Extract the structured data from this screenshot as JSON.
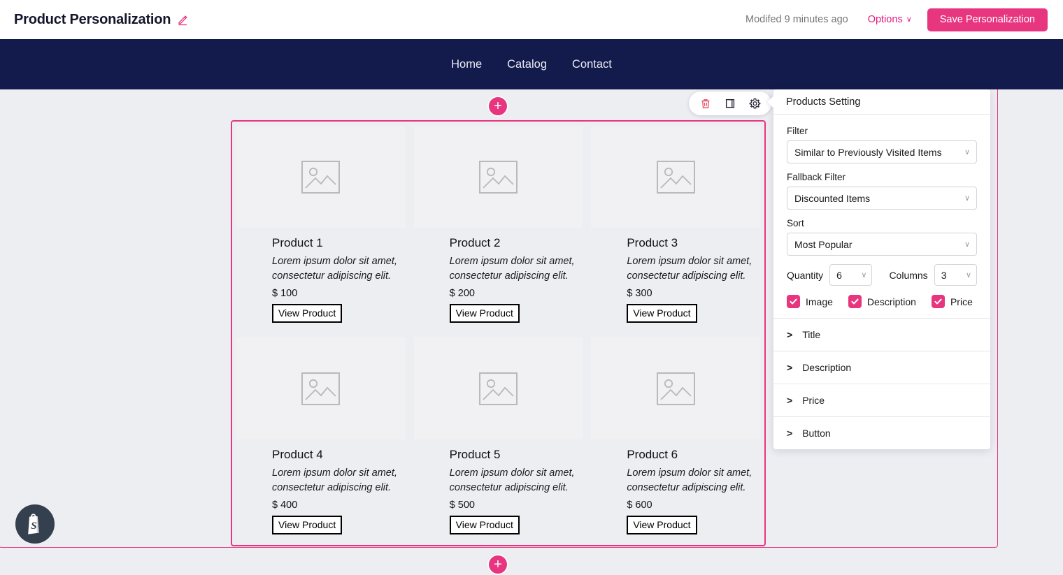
{
  "header": {
    "title": "Product Personalization",
    "edit_icon": "pencil-icon",
    "modified": "Modifed 9 minutes ago",
    "options_label": "Options",
    "options_caret": "∨",
    "save_label": "Save Personalization"
  },
  "storenav": {
    "items": [
      {
        "label": "Home"
      },
      {
        "label": "Catalog"
      },
      {
        "label": "Contact"
      }
    ]
  },
  "canvas": {
    "add_button_label": "+",
    "toolbar": [
      {
        "icon": "trash-icon"
      },
      {
        "icon": "duplicate-icon"
      },
      {
        "icon": "gear-icon"
      }
    ],
    "shopify_badge_icon": "shopify-bag-icon"
  },
  "products": [
    {
      "title": "Product 1",
      "description": "Lorem ipsum dolor sit amet, consectetur adipiscing elit.",
      "price": "$ 100",
      "button": "View Product",
      "image_icon": "image-placeholder-icon"
    },
    {
      "title": "Product 2",
      "description": "Lorem ipsum dolor sit amet, consectetur adipiscing elit.",
      "price": "$ 200",
      "button": "View Product",
      "image_icon": "image-placeholder-icon"
    },
    {
      "title": "Product 3",
      "description": "Lorem ipsum dolor sit amet, consectetur adipiscing elit.",
      "price": "$ 300",
      "button": "View Product",
      "image_icon": "image-placeholder-icon"
    },
    {
      "title": "Product 4",
      "description": "Lorem ipsum dolor sit amet, consectetur adipiscing elit.",
      "price": "$ 400",
      "button": "View Product",
      "image_icon": "image-placeholder-icon"
    },
    {
      "title": "Product 5",
      "description": "Lorem ipsum dolor sit amet, consectetur adipiscing elit.",
      "price": "$ 500",
      "button": "View Product",
      "image_icon": "image-placeholder-icon"
    },
    {
      "title": "Product 6",
      "description": "Lorem ipsum dolor sit amet, consectetur adipiscing elit.",
      "price": "$ 600",
      "button": "View Product",
      "image_icon": "image-placeholder-icon"
    }
  ],
  "panel": {
    "title": "Products Setting",
    "filter": {
      "label": "Filter",
      "value": "Similar to Previously Visited Items"
    },
    "fallback_filter": {
      "label": "Fallback Filter",
      "value": "Discounted Items"
    },
    "sort": {
      "label": "Sort",
      "value": "Most Popular"
    },
    "quantity": {
      "label": "Quantity",
      "value": "6"
    },
    "columns": {
      "label": "Columns",
      "value": "3"
    },
    "checkboxes": [
      {
        "label": "Image",
        "checked": true
      },
      {
        "label": "Description",
        "checked": true
      },
      {
        "label": "Price",
        "checked": true
      }
    ],
    "accordions": [
      {
        "label": "Title",
        "chevron": ">"
      },
      {
        "label": "Description",
        "chevron": ">"
      },
      {
        "label": "Price",
        "chevron": ">"
      },
      {
        "label": "Button",
        "chevron": ">"
      }
    ]
  },
  "colors": {
    "accent_pink": "#e8357f",
    "nav_navy": "#131b4d",
    "canvas_bg": "#edeef2",
    "placeholder_gray": "#f1f1f3",
    "trash_red": "#e8455a"
  }
}
